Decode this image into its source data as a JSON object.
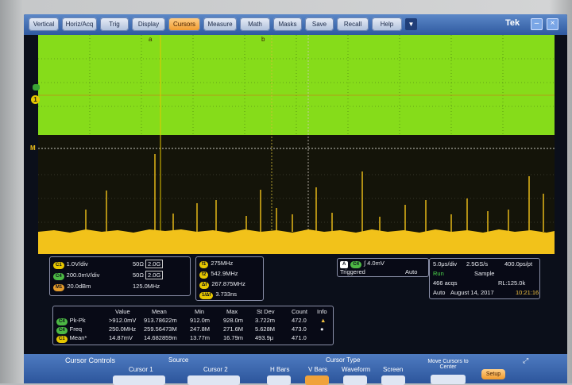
{
  "menu": {
    "items": [
      "Vertical",
      "Horiz/Acq",
      "Trig",
      "Display",
      "Cursors",
      "Measure",
      "Math",
      "Masks",
      "Save",
      "Recall",
      "Help"
    ],
    "active": "Cursors",
    "brand": "Tek"
  },
  "graticule": {
    "cursor_a": "a",
    "cursor_b": "b",
    "ch_marker": "1",
    "math_marker": "M"
  },
  "channels": {
    "c1": {
      "tag": "C1",
      "scale": "1.0V/div",
      "imp": "50Ω",
      "bw": "2.0G"
    },
    "c4": {
      "tag": "C4",
      "scale": "200.0mV/div",
      "imp": "50Ω",
      "bw": "2.0G"
    },
    "m1": {
      "tag": "M1",
      "scale": "20.0dBm",
      "freq": "125.0MHz"
    }
  },
  "cursors": {
    "f1": {
      "tag": "f1",
      "value": "275MHz"
    },
    "f2": {
      "tag": "f2",
      "value": "542.9MHz"
    },
    "df": {
      "tag": "Δf",
      "value": "267.875MHz"
    },
    "dt": {
      "tag": "1/Δf",
      "value": "3.733ns"
    }
  },
  "trigger": {
    "source": "A",
    "ch": "C4",
    "edge": "∫",
    "level": "4.0mV",
    "state": "Triggered",
    "mode": "Auto"
  },
  "acq": {
    "timebase": "5.0μs/div",
    "rate": "2.5GS/s",
    "res": "400.0ps/pt",
    "run": "Run",
    "mode": "Sample",
    "acqs": "466 acqs",
    "rl": "RL:125.0k",
    "auto": "Auto",
    "date": "August 14, 2017",
    "time": "10:21:16"
  },
  "measurements": {
    "headers": [
      "Value",
      "Mean",
      "Min",
      "Max",
      "St Dev",
      "Count",
      "Info"
    ],
    "rows": [
      {
        "ch": "C4",
        "name": "Pk-Pk",
        "values": [
          ">912.0mV",
          "913.78622m",
          "912.0m",
          "928.0m",
          "3.722m",
          "472.0",
          "▲"
        ]
      },
      {
        "ch": "C4",
        "name": "Freq",
        "values": [
          "250.0MHz",
          "259.56473M",
          "247.8M",
          "271.6M",
          "5.628M",
          "473.0",
          "●"
        ]
      },
      {
        "ch": "C1",
        "name": "Mean*",
        "values": [
          "14.87mV",
          "14.682859m",
          "13.77m",
          "16.79m",
          "493.9μ",
          "471.0",
          ""
        ]
      }
    ]
  },
  "bottom": {
    "cursor_controls": "Cursor Controls",
    "source": "Source",
    "cursor1": "Cursor 1",
    "cursor2": "Cursor 2",
    "cursor_type": "Cursor Type",
    "hbars": "H Bars",
    "vbars": "V Bars",
    "waveform": "Waveform",
    "screen": "Screen",
    "move": "Move Cursors to Center",
    "setup": "Setup"
  }
}
